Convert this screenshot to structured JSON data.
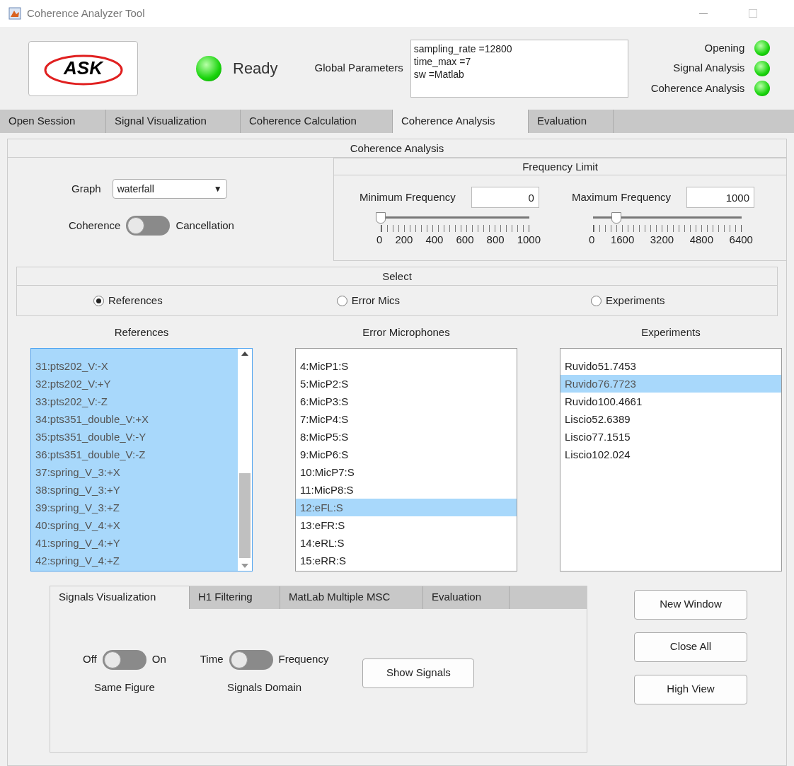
{
  "window": {
    "title": "Coherence Analyzer Tool"
  },
  "header": {
    "logo": {
      "text": "ASK"
    },
    "status": {
      "label": "Ready",
      "on": true
    },
    "global_parameters": {
      "label": "Global Parameters",
      "lines": [
        "sampling_rate =12800",
        "time_max =7",
        "sw =Matlab"
      ]
    },
    "indicators": [
      {
        "label": "Opening",
        "on": true
      },
      {
        "label": "Signal Analysis",
        "on": true
      },
      {
        "label": "Coherence Analysis",
        "on": true
      }
    ]
  },
  "tabs": [
    {
      "label": "Open Session",
      "selected": false
    },
    {
      "label": "Signal Visualization",
      "selected": false
    },
    {
      "label": "Coherence Calculation",
      "selected": false
    },
    {
      "label": "Coherence Analysis",
      "selected": true
    },
    {
      "label": "Evaluation",
      "selected": false
    }
  ],
  "panel_title": "Coherence Analysis",
  "graph": {
    "label": "Graph",
    "value": "waterfall",
    "caret": "▼"
  },
  "mode_switch": {
    "left": "Coherence",
    "right": "Cancellation",
    "on": false
  },
  "frequency_limit": {
    "title": "Frequency Limit",
    "sliders": [
      {
        "label": "Minimum Frequency",
        "value": "0",
        "level": 0,
        "ticks": [
          "0",
          "200",
          "400",
          "600",
          "800",
          "1000"
        ]
      },
      {
        "label": "Maximum Frequency",
        "value": "1000",
        "level": 0.156,
        "ticks": [
          "0",
          "1600",
          "3200",
          "4800",
          "6400"
        ]
      }
    ]
  },
  "select": {
    "title": "Select",
    "options": [
      {
        "label": "References",
        "selected": true
      },
      {
        "label": "Error Mics",
        "selected": false
      },
      {
        "label": "Experiments",
        "selected": false
      }
    ]
  },
  "lists": [
    {
      "title": "References",
      "scrollbar": true,
      "items": [
        {
          "label": "31:pts202_V:-X",
          "selected": true
        },
        {
          "label": "32:pts202_V:+Y",
          "selected": true
        },
        {
          "label": "33:pts202_V:-Z",
          "selected": true
        },
        {
          "label": "34:pts351_double_V:+X",
          "selected": true
        },
        {
          "label": "35:pts351_double_V:-Y",
          "selected": true
        },
        {
          "label": "36:pts351_double_V:-Z",
          "selected": true
        },
        {
          "label": "37:spring_V_3:+X",
          "selected": true
        },
        {
          "label": "38:spring_V_3:+Y",
          "selected": true
        },
        {
          "label": "39:spring_V_3:+Z",
          "selected": true
        },
        {
          "label": "40:spring_V_4:+X",
          "selected": true
        },
        {
          "label": "41:spring_V_4:+Y",
          "selected": true
        },
        {
          "label": "42:spring_V_4:+Z",
          "selected": true
        }
      ]
    },
    {
      "title": "Error Microphones",
      "scrollbar": false,
      "items": [
        {
          "label": "4:MicP1:S",
          "selected": false
        },
        {
          "label": "5:MicP2:S",
          "selected": false
        },
        {
          "label": "6:MicP3:S",
          "selected": false
        },
        {
          "label": "7:MicP4:S",
          "selected": false
        },
        {
          "label": "8:MicP5:S",
          "selected": false
        },
        {
          "label": "9:MicP6:S",
          "selected": false
        },
        {
          "label": "10:MicP7:S",
          "selected": false
        },
        {
          "label": "11:MicP8:S",
          "selected": false
        },
        {
          "label": "12:eFL:S",
          "selected": true
        },
        {
          "label": "13:eFR:S",
          "selected": false
        },
        {
          "label": "14:eRL:S",
          "selected": false
        },
        {
          "label": "15:eRR:S",
          "selected": false
        }
      ]
    },
    {
      "title": "Experiments",
      "scrollbar": false,
      "items": [
        {
          "label": "Ruvido51.7453",
          "selected": false
        },
        {
          "label": "Ruvido76.7723",
          "selected": true
        },
        {
          "label": "Ruvido100.4661",
          "selected": false
        },
        {
          "label": "Liscio52.6389",
          "selected": false
        },
        {
          "label": "Liscio77.1515",
          "selected": false
        },
        {
          "label": "Liscio102.024",
          "selected": false
        }
      ]
    }
  ],
  "sub_tabs": [
    {
      "label": "Signals Visualization",
      "selected": true
    },
    {
      "label": "H1 Filtering",
      "selected": false
    },
    {
      "label": "MatLab Multiple MSC",
      "selected": false
    },
    {
      "label": "Evaluation",
      "selected": false
    }
  ],
  "switches": [
    {
      "left": "Off",
      "right": "On",
      "caption": "Same Figure",
      "on": false
    },
    {
      "left": "Time",
      "right": "Frequency",
      "caption": "Signals Domain",
      "on": false
    }
  ],
  "show_button": "Show Signals",
  "side_buttons": [
    "New Window",
    "Close All",
    "High View"
  ]
}
